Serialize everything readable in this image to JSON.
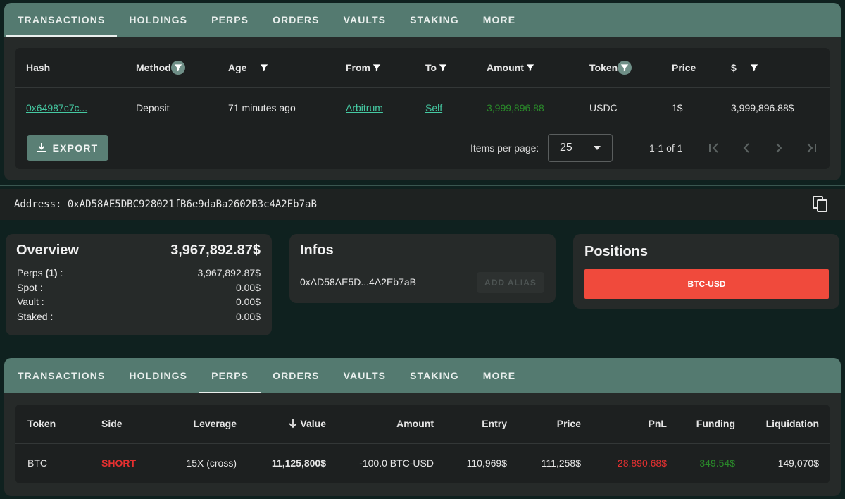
{
  "top_panel": {
    "tabs": [
      {
        "label": "TRANSACTIONS"
      },
      {
        "label": "HOLDINGS"
      },
      {
        "label": "PERPS"
      },
      {
        "label": "ORDERS"
      },
      {
        "label": "VAULTS"
      },
      {
        "label": "STAKING"
      },
      {
        "label": "MORE"
      }
    ],
    "active_tab": "TRANSACTIONS",
    "columns": [
      "Hash",
      "Method",
      "Age",
      "From",
      "To",
      "Amount",
      "Token",
      "Price",
      "$"
    ],
    "rows": [
      {
        "hash": "0x64987c7c...",
        "method": "Deposit",
        "age": "71 minutes ago",
        "from": "Arbitrum",
        "to": "Self",
        "amount": "3,999,896.88",
        "token": "USDC",
        "price": "1$",
        "usd": "3,999,896.88$"
      }
    ],
    "export_label": "EXPORT",
    "items_per_page_label": "Items per page:",
    "items_per_page_value": "25",
    "range_label": "1-1 of 1"
  },
  "address": {
    "label": "Address:",
    "value": "0xAD58AE5DBC928021fB6e9daBa2602B3c4A2Eb7aB"
  },
  "overview": {
    "title": "Overview",
    "total": "3,967,892.87$",
    "perps_label": "Perps",
    "perps_count": "(1)",
    "perps_colon": ":",
    "perps_value": "3,967,892.87$",
    "spot_label": "Spot :",
    "spot_value": "0.00$",
    "vault_label": "Vault :",
    "vault_value": "0.00$",
    "staked_label": "Staked :",
    "staked_value": "0.00$"
  },
  "infos": {
    "title": "Infos",
    "short_address": "0xAD58AE5D...4A2Eb7aB",
    "add_alias_label": "ADD ALIAS"
  },
  "positions": {
    "title": "Positions",
    "button_label": "BTC-USD",
    "button_color": "#f04a3c"
  },
  "bottom_panel": {
    "tabs": [
      {
        "label": "TRANSACTIONS"
      },
      {
        "label": "HOLDINGS"
      },
      {
        "label": "PERPS"
      },
      {
        "label": "ORDERS"
      },
      {
        "label": "VAULTS"
      },
      {
        "label": "STAKING"
      },
      {
        "label": "MORE"
      }
    ],
    "active_tab": "PERPS",
    "columns": [
      "Token",
      "Side",
      "Leverage",
      "Value",
      "Amount",
      "Entry",
      "Price",
      "PnL",
      "Funding",
      "Liquidation"
    ],
    "rows": [
      {
        "token": "BTC",
        "side": "SHORT",
        "leverage": "15X (cross)",
        "value": "11,125,800$",
        "amount": "-100.0 BTC-USD",
        "entry": "110,969$",
        "price": "111,258$",
        "pnl": "-28,890.68$",
        "funding": "349.54$",
        "liquidation": "149,070$"
      }
    ]
  },
  "colors": {
    "tab_bar": "#547a70",
    "panel_bg": "#262a29",
    "page_bg": "#0f211f",
    "link": "#45c9a2",
    "negative": "#e53030",
    "positive": "#3fb83f"
  },
  "icons": [
    "filter-icon",
    "download-icon",
    "chevron-down-icon",
    "first-page-icon",
    "prev-page-icon",
    "next-page-icon",
    "last-page-icon",
    "copy-icon",
    "arrow-down-icon"
  ]
}
